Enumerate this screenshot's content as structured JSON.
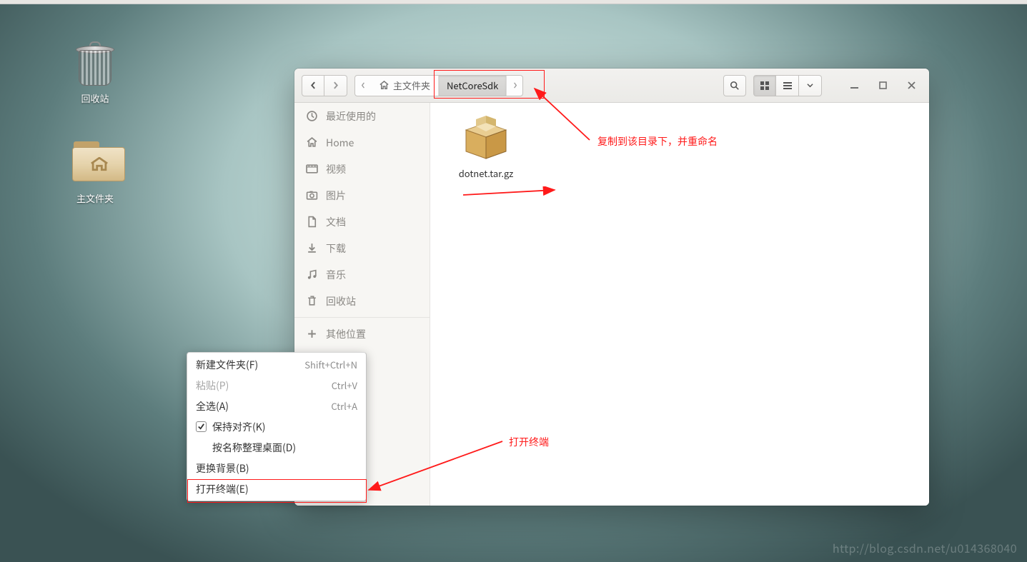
{
  "desktop": {
    "trash_label": "回收站",
    "home_label": "主文件夹"
  },
  "filemanager": {
    "path": {
      "home_label": "主文件夹",
      "current": "NetCoreSdk"
    },
    "sidebar": {
      "recent": "最近使用的",
      "home": "Home",
      "videos": "视频",
      "pictures": "图片",
      "documents": "文档",
      "downloads": "下载",
      "music": "音乐",
      "trash": "回收站",
      "other": "其他位置"
    },
    "file": {
      "name": "dotnet.tar.gz"
    }
  },
  "context_menu": {
    "new_folder": {
      "label": "新建文件夹(F)",
      "accel": "Shift+Ctrl+N"
    },
    "paste": {
      "label": "粘贴(P)",
      "accel": "Ctrl+V"
    },
    "select_all": {
      "label": "全选(A)",
      "accel": "Ctrl+A"
    },
    "keep_aligned": "保持对齐(K)",
    "sort_by_name": "按名称整理桌面(D)",
    "change_bg": "更换背景(B)",
    "open_terminal": "打开终端(E)"
  },
  "annotation": {
    "copy_rename": "复制到该目录下，并重命名",
    "open_terminal": "打开终端"
  },
  "watermark": "http://blog.csdn.net/u014368040"
}
